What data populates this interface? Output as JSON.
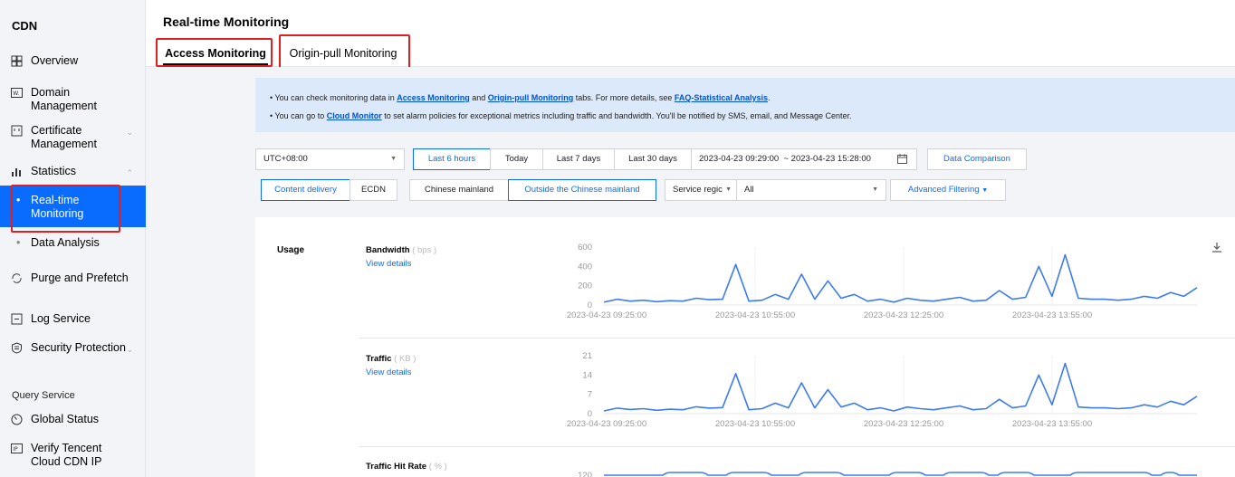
{
  "sidebar": {
    "brand": "CDN",
    "items": [
      {
        "label": "Overview",
        "icon": "grid-icon"
      },
      {
        "label": "Domain Management",
        "icon": "domain-icon"
      },
      {
        "label": "Certificate Management",
        "icon": "certificate-icon"
      },
      {
        "label": "Statistics",
        "icon": "bar-chart-icon"
      },
      {
        "label": "Real-time Monitoring"
      },
      {
        "label": "Data Analysis"
      },
      {
        "label": "Purge and Prefetch",
        "icon": "refresh-icon"
      },
      {
        "label": "Log Service",
        "icon": "log-icon"
      },
      {
        "label": "Security Protection",
        "icon": "shield-icon"
      },
      {
        "label": "Global Status",
        "icon": "gauge-icon"
      },
      {
        "label": "Verify Tencent Cloud CDN IP",
        "icon": "ip-icon"
      }
    ],
    "section_label": "Query Service"
  },
  "header": {
    "title": "Real-time Monitoring",
    "tabs": [
      "Access Monitoring",
      "Origin-pull Monitoring"
    ]
  },
  "notice": {
    "line1": {
      "t1": "• You can check monitoring data in ",
      "link1": "Access Monitoring",
      "t2": " and ",
      "link2": "Origin-pull Monitoring",
      "t3": " tabs. For more details, see ",
      "link3": "FAQ-Statistical Analysis",
      "t4": "."
    },
    "line2": {
      "t1": "• You can go to ",
      "link1": "Cloud Monitor",
      "t2": " to set alarm policies for exceptional metrics including traffic and bandwidth. You'll be notified by SMS, email, and Message Center."
    }
  },
  "filters": {
    "timezone": "UTC+08:00",
    "ranges": [
      "Last 6 hours",
      "Today",
      "Last 7 days",
      "Last 30 days"
    ],
    "date_start": "2023-04-23 09:29:00",
    "date_end": "~ 2023-04-23 15:28:00",
    "compare": "Data Comparison",
    "products": [
      "Content delivery",
      "ECDN"
    ],
    "regions": [
      "Chinese mainland",
      "Outside the Chinese mainland"
    ],
    "service_region_label": "Service regic",
    "service_region_value": "All",
    "advanced": "Advanced Filtering"
  },
  "panel": {
    "section": "Usage",
    "view_details": "View details",
    "metrics": [
      {
        "name": "Bandwidth",
        "unit": "( bps )",
        "yticks": [
          "600",
          "400",
          "200",
          "0"
        ]
      },
      {
        "name": "Traffic",
        "unit": "( KB )",
        "yticks": [
          "21",
          "14",
          "7",
          "0"
        ]
      },
      {
        "name": "Traffic Hit Rate",
        "unit": "( % )",
        "yticks": [
          "120"
        ]
      }
    ],
    "xticks": [
      "2023-04-23 09:25:00",
      "2023-04-23 10:55:00",
      "2023-04-23 12:25:00",
      "2023-04-23 13:55:00"
    ]
  },
  "chart_data": [
    {
      "type": "line",
      "title": "Bandwidth",
      "ylabel": "bps",
      "ylim": [
        0,
        600
      ],
      "x": [
        "2023-04-23 09:25:00",
        "2023-04-23 10:55:00",
        "2023-04-23 12:25:00",
        "2023-04-23 13:55:00"
      ],
      "values": [
        30,
        60,
        40,
        50,
        35,
        45,
        40,
        70,
        55,
        60,
        420,
        40,
        50,
        110,
        60,
        320,
        60,
        250,
        70,
        110,
        40,
        60,
        30,
        70,
        50,
        40,
        60,
        80,
        40,
        50,
        150,
        60,
        80,
        400,
        90,
        520,
        70,
        60,
        60,
        50,
        60,
        90,
        70,
        130,
        90,
        180
      ],
      "color": "#3d7bf0"
    },
    {
      "type": "line",
      "title": "Traffic",
      "ylabel": "KB",
      "ylim": [
        0,
        21
      ],
      "x": [
        "2023-04-23 09:25:00",
        "2023-04-23 10:55:00",
        "2023-04-23 12:25:00",
        "2023-04-23 13:55:00"
      ],
      "values": [
        1,
        2,
        1.5,
        1.8,
        1.2,
        1.6,
        1.4,
        2.5,
        2,
        2.2,
        14.5,
        1.4,
        1.8,
        3.8,
        2.1,
        11.2,
        2.1,
        8.7,
        2.4,
        3.8,
        1.4,
        2.1,
        1,
        2.4,
        1.8,
        1.4,
        2.1,
        2.8,
        1.4,
        1.8,
        5.2,
        2.1,
        2.8,
        14,
        3.2,
        18.2,
        2.4,
        2.1,
        2.1,
        1.8,
        2.1,
        3.2,
        2.4,
        4.5,
        3.2,
        6.3
      ],
      "color": "#3d7bf0"
    }
  ]
}
